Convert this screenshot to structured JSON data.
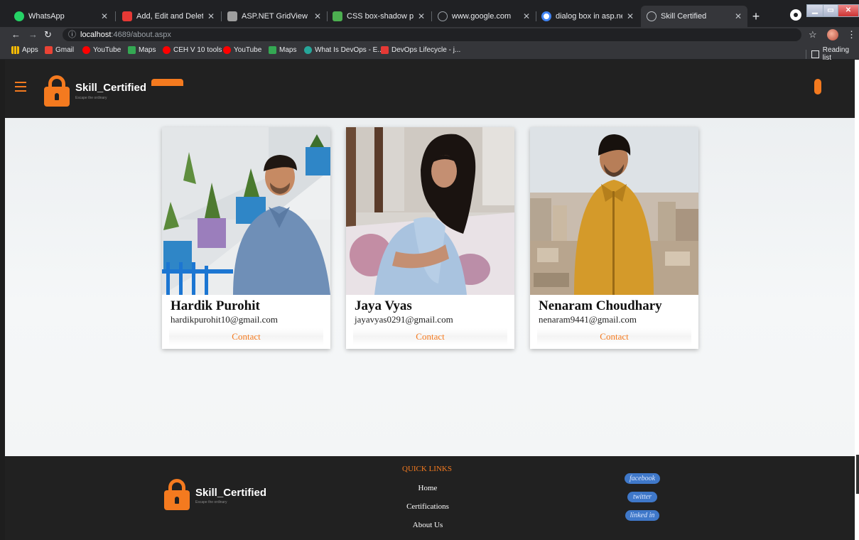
{
  "browser": {
    "tabs": [
      {
        "label": "WhatsApp",
        "icon": "whatsapp-icon",
        "color": "#25d366"
      },
      {
        "label": "Add, Edit and Delete Data",
        "icon": "c-icon",
        "color": "#e53935"
      },
      {
        "label": "ASP.NET GridView makeo",
        "icon": "grid-icon",
        "color": "#9e9e9e"
      },
      {
        "label": "CSS box-shadow property",
        "icon": "w3-icon",
        "color": "#4caf50"
      },
      {
        "label": "www.google.com",
        "icon": "globe-icon",
        "color": "#9aa0a6"
      },
      {
        "label": "dialog box in asp.net c# -",
        "icon": "google-icon",
        "color": "#ffffff"
      },
      {
        "label": "Skill Certified",
        "icon": "globe-icon",
        "color": "#9aa0a6"
      }
    ],
    "url_host": "localhost",
    "url_path": ":4689/about.aspx",
    "bookmarks": [
      {
        "label": "Apps",
        "color": "#fbbc04"
      },
      {
        "label": "Gmail",
        "color": "#ea4335"
      },
      {
        "label": "YouTube",
        "color": "#ff0000"
      },
      {
        "label": "Maps",
        "color": "#34a853"
      },
      {
        "label": "CEH V 10 tools",
        "color": "#ff0000"
      },
      {
        "label": "YouTube",
        "color": "#ff0000"
      },
      {
        "label": "Maps",
        "color": "#34a853"
      },
      {
        "label": "What Is DevOps - E...",
        "color": "#26a69a"
      },
      {
        "label": "DevOps Lifecycle - j...",
        "color": "#e53935"
      }
    ],
    "reading_list": "Reading list"
  },
  "header": {
    "brand": "Skill_Certified",
    "tagline": "Escape the ordinary",
    "accent": "#f47a1f"
  },
  "team": [
    {
      "name": "Hardik Purohit",
      "email": "hardikpurohit10@gmail.com",
      "contact": "Contact"
    },
    {
      "name": "Jaya Vyas",
      "email": "jayavyas0291@gmail.com",
      "contact": "Contact"
    },
    {
      "name": "Nenaram Choudhary",
      "email": "nenaram9441@gmail.com",
      "contact": "Contact"
    }
  ],
  "footer": {
    "brand": "Skill_Certified",
    "tagline": "Escape the ordinary",
    "quick_links_title": "QUICK LINKS",
    "links": [
      "Home",
      "Certifications",
      "About Us"
    ],
    "social": [
      "facebook",
      "twitter",
      "linked in"
    ]
  }
}
